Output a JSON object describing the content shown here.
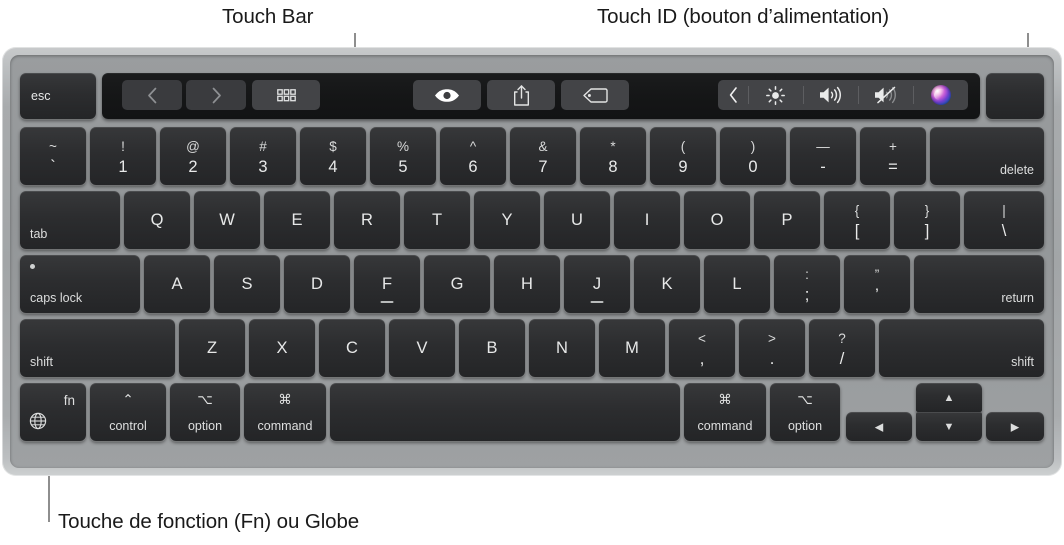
{
  "annotations": [
    {
      "id": "touch-bar",
      "label": "Touch Bar"
    },
    {
      "id": "touch-id",
      "label": "Touch ID (bouton d’alimentation)"
    },
    {
      "id": "fn-globe",
      "label": "Touche de fonction (Fn) ou Globe"
    }
  ],
  "colors": {
    "page_background": "#ffffff",
    "chassis": "#a8abad",
    "key_face": "#2c2d2f",
    "key_text": "#e9eaea",
    "touch_bar_background": "#151617",
    "touch_bar_button": "#434447",
    "leader_line": "#8e8e8e",
    "caption_text": "#1a1a1a"
  },
  "keyboard": {
    "esc_key": {
      "label": "esc",
      "name": "escape-key"
    },
    "touch_id_key": {
      "label": "",
      "name": "touch-id-key"
    },
    "touch_bar": {
      "left_buttons": [
        {
          "name": "back-icon",
          "glyph": "chevron-left",
          "dim": true
        },
        {
          "name": "forward-icon",
          "glyph": "chevron-right",
          "dim": true
        },
        {
          "name": "grid-view-icon",
          "glyph": "grid"
        }
      ],
      "center_buttons": [
        {
          "name": "quick-look-eye-icon",
          "glyph": "eye"
        },
        {
          "name": "share-icon",
          "glyph": "share"
        },
        {
          "name": "tag-icon",
          "glyph": "tag"
        }
      ],
      "control_strip": [
        {
          "name": "expand-control-strip-icon",
          "glyph": "chevron-left-thin"
        },
        {
          "name": "brightness-icon",
          "glyph": "brightness"
        },
        {
          "name": "volume-up-icon",
          "glyph": "volume"
        },
        {
          "name": "mute-icon",
          "glyph": "volume-mute"
        },
        {
          "name": "siri-icon",
          "glyph": "siri"
        }
      ]
    },
    "rows": {
      "number_row": [
        {
          "name": "key-backtick",
          "upper": "~",
          "lower": "`"
        },
        {
          "name": "key-1",
          "upper": "!",
          "lower": "1"
        },
        {
          "name": "key-2",
          "upper": "@",
          "lower": "2"
        },
        {
          "name": "key-3",
          "upper": "#",
          "lower": "3"
        },
        {
          "name": "key-4",
          "upper": "$",
          "lower": "4"
        },
        {
          "name": "key-5",
          "upper": "%",
          "lower": "5"
        },
        {
          "name": "key-6",
          "upper": "^",
          "lower": "6"
        },
        {
          "name": "key-7",
          "upper": "&",
          "lower": "7"
        },
        {
          "name": "key-8",
          "upper": "*",
          "lower": "8"
        },
        {
          "name": "key-9",
          "upper": "(",
          "lower": "9"
        },
        {
          "name": "key-0",
          "upper": ")",
          "lower": "0"
        },
        {
          "name": "key-minus",
          "upper": "—",
          "lower": "-"
        },
        {
          "name": "key-equals",
          "upper": "+",
          "lower": "="
        },
        {
          "name": "key-delete",
          "label": "delete"
        }
      ],
      "top_letter_row": [
        {
          "name": "key-tab",
          "label": "tab"
        },
        {
          "name": "key-q",
          "label": "Q"
        },
        {
          "name": "key-w",
          "label": "W"
        },
        {
          "name": "key-e",
          "label": "E"
        },
        {
          "name": "key-r",
          "label": "R"
        },
        {
          "name": "key-t",
          "label": "T"
        },
        {
          "name": "key-y",
          "label": "Y"
        },
        {
          "name": "key-u",
          "label": "U"
        },
        {
          "name": "key-i",
          "label": "I"
        },
        {
          "name": "key-o",
          "label": "O"
        },
        {
          "name": "key-p",
          "label": "P"
        },
        {
          "name": "key-left-bracket",
          "upper": "{",
          "lower": "["
        },
        {
          "name": "key-right-bracket",
          "upper": "}",
          "lower": "]"
        },
        {
          "name": "key-backslash",
          "upper": "|",
          "lower": "\\"
        }
      ],
      "home_row": [
        {
          "name": "key-caps-lock",
          "label": "caps lock"
        },
        {
          "name": "key-a",
          "label": "A"
        },
        {
          "name": "key-s",
          "label": "S"
        },
        {
          "name": "key-d",
          "label": "D"
        },
        {
          "name": "key-f",
          "label": "F",
          "homing": true
        },
        {
          "name": "key-g",
          "label": "G"
        },
        {
          "name": "key-h",
          "label": "H"
        },
        {
          "name": "key-j",
          "label": "J",
          "homing": true
        },
        {
          "name": "key-k",
          "label": "K"
        },
        {
          "name": "key-l",
          "label": "L"
        },
        {
          "name": "key-semicolon",
          "upper": ":",
          "lower": ";"
        },
        {
          "name": "key-quote",
          "upper": "”",
          "lower": "’"
        },
        {
          "name": "key-return",
          "label": "return"
        }
      ],
      "bottom_letter_row": [
        {
          "name": "key-left-shift",
          "label": "shift"
        },
        {
          "name": "key-z",
          "label": "Z"
        },
        {
          "name": "key-x",
          "label": "X"
        },
        {
          "name": "key-c",
          "label": "C"
        },
        {
          "name": "key-v",
          "label": "V"
        },
        {
          "name": "key-b",
          "label": "B"
        },
        {
          "name": "key-n",
          "label": "N"
        },
        {
          "name": "key-m",
          "label": "M"
        },
        {
          "name": "key-comma",
          "upper": "<",
          "lower": ","
        },
        {
          "name": "key-period",
          "upper": ">",
          "lower": "."
        },
        {
          "name": "key-slash",
          "upper": "?",
          "lower": "/"
        },
        {
          "name": "key-right-shift",
          "label": "shift"
        }
      ],
      "modifier_row": [
        {
          "name": "key-fn-globe",
          "label": "fn",
          "icon": "globe-icon"
        },
        {
          "name": "key-left-control",
          "symbol": "⌃",
          "label": "control"
        },
        {
          "name": "key-left-option",
          "symbol": "⌥",
          "label": "option"
        },
        {
          "name": "key-left-command",
          "symbol": "⌘",
          "label": "command"
        },
        {
          "name": "key-space",
          "label": ""
        },
        {
          "name": "key-right-command",
          "symbol": "⌘",
          "label": "command"
        },
        {
          "name": "key-right-option",
          "symbol": "⌥",
          "label": "option"
        },
        {
          "name": "key-arrow-left",
          "label": "◀"
        },
        {
          "name": "key-arrow-up",
          "label": "▲"
        },
        {
          "name": "key-arrow-down",
          "label": "▼"
        },
        {
          "name": "key-arrow-right",
          "label": "▶"
        }
      ]
    }
  }
}
